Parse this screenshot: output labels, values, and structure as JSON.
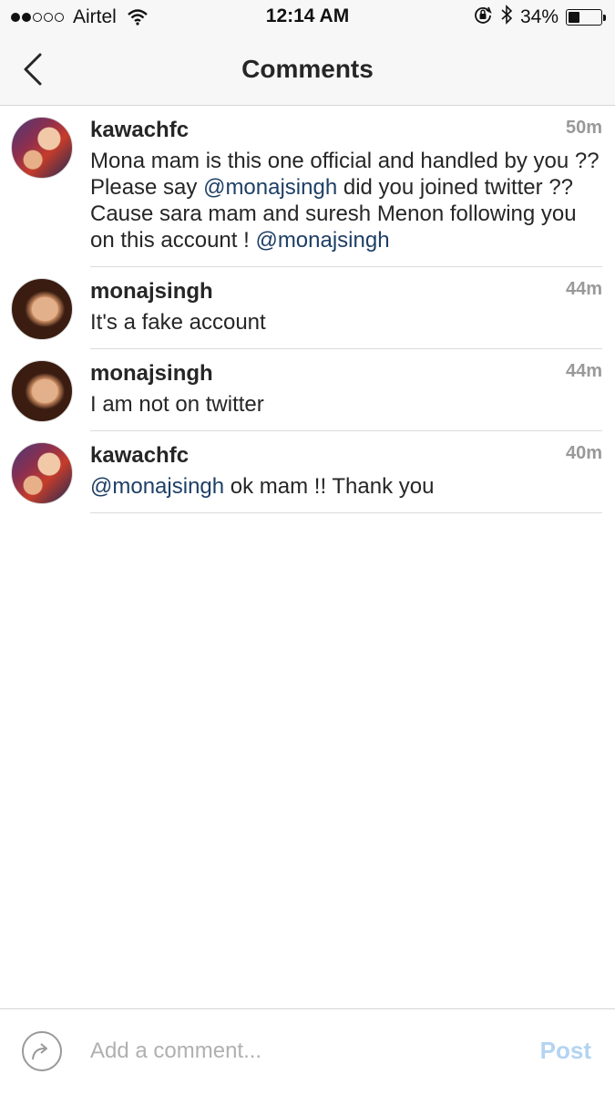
{
  "status_bar": {
    "carrier": "Airtel",
    "time": "12:14 AM",
    "battery_percent": "34%",
    "battery_level": 0.34,
    "signal_bars_filled": 2,
    "signal_bars_total": 5,
    "icons": [
      "wifi-icon",
      "rotation-lock-icon",
      "bluetooth-icon",
      "battery-icon"
    ]
  },
  "nav": {
    "title": "Comments",
    "back_icon": "chevron-left-icon"
  },
  "comments": [
    {
      "username": "kawachfc",
      "time": "50m",
      "avatar": "kawachfc-avatar",
      "segments": [
        {
          "text": "Mona mam is this one official and handled by you ?? Please say ",
          "mention": false
        },
        {
          "text": "@monajsingh",
          "mention": true
        },
        {
          "text": " did you joined twitter ?? Cause sara mam and suresh Menon following you on this account ! ",
          "mention": false
        },
        {
          "text": "@monajsingh",
          "mention": true
        }
      ]
    },
    {
      "username": "monajsingh",
      "time": "44m",
      "avatar": "monajsingh-avatar",
      "segments": [
        {
          "text": "It's a fake account",
          "mention": false
        }
      ]
    },
    {
      "username": "monajsingh",
      "time": "44m",
      "avatar": "monajsingh-avatar",
      "segments": [
        {
          "text": "I am not on twitter",
          "mention": false
        }
      ]
    },
    {
      "username": "kawachfc",
      "time": "40m",
      "avatar": "kawachfc-avatar",
      "segments": [
        {
          "text": "@monajsingh",
          "mention": true
        },
        {
          "text": " ok mam !! Thank you",
          "mention": false
        }
      ]
    }
  ],
  "composer": {
    "placeholder": "Add a comment...",
    "value": "",
    "post_label": "Post",
    "share_icon": "share-icon"
  },
  "colors": {
    "mention": "#1e3f66",
    "post_disabled": "#b3d4f1",
    "timestamp": "#999999",
    "text": "#262626"
  }
}
